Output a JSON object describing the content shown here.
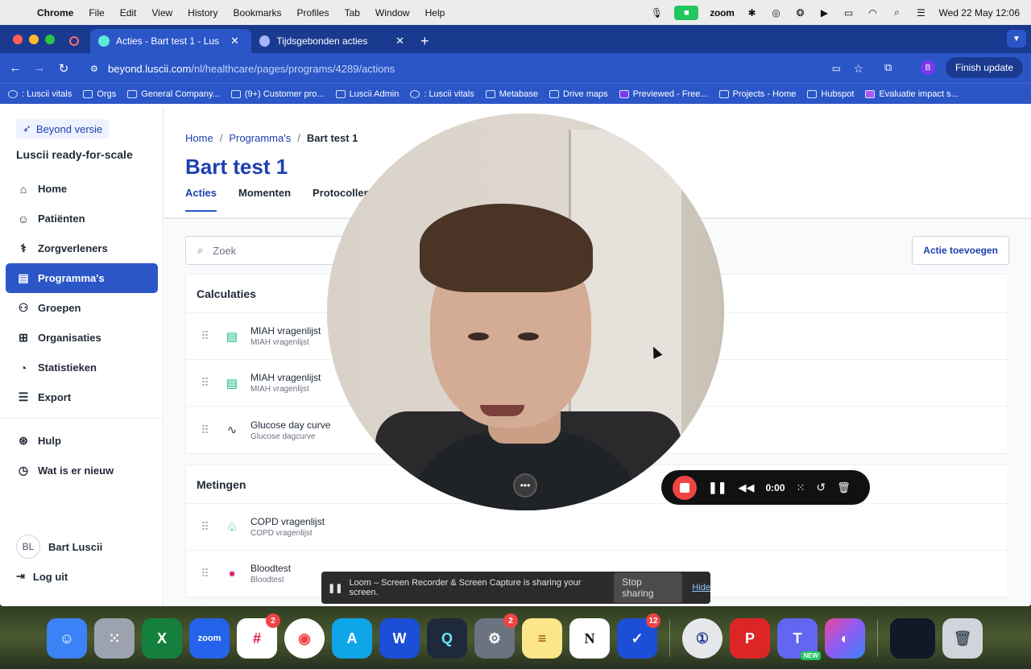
{
  "menubar": {
    "app": "Chrome",
    "items": [
      "File",
      "Edit",
      "View",
      "History",
      "Bookmarks",
      "Profiles",
      "Tab",
      "Window",
      "Help"
    ],
    "zoom_label": "zoom",
    "clock": "Wed 22 May  12:06"
  },
  "browser": {
    "tabs": [
      {
        "title": "Acties - Bart test 1 - Lusc"
      },
      {
        "title": "Tijdsgebonden acties"
      }
    ],
    "url_host": "beyond.luscii.com",
    "url_path": "/nl/healthcare/pages/programs/4289/actions",
    "finish_update": "Finish update",
    "profile_initial": "B",
    "bookmarks": [
      ": Luscii vitals",
      "Orgs",
      "General Company...",
      "(9+) Customer pro...",
      "Luscii Admin",
      ": Luscii vitals",
      "Metabase",
      "Drive maps",
      "Previewed - Free...",
      "Projects - Home",
      "Hubspot",
      "Evaluatie impact s..."
    ]
  },
  "sidebar": {
    "badge": "Beyond versie",
    "org": "Luscii ready-for-scale",
    "items": [
      {
        "label": "Home"
      },
      {
        "label": "Patiënten"
      },
      {
        "label": "Zorgverleners"
      },
      {
        "label": "Programma's"
      },
      {
        "label": "Groepen"
      },
      {
        "label": "Organisaties"
      },
      {
        "label": "Statistieken"
      },
      {
        "label": "Export"
      }
    ],
    "secondary": [
      {
        "label": "Hulp"
      },
      {
        "label": "Wat is er nieuw"
      }
    ],
    "user_initials": "BL",
    "user_name": "Bart Luscii",
    "logout": "Log uit"
  },
  "main": {
    "breadcrumb": [
      "Home",
      "Programma's",
      "Bart test 1"
    ],
    "title": "Bart test 1",
    "tabs": [
      "Acties",
      "Momenten",
      "Protocollen"
    ],
    "search_placeholder": "Zoek",
    "add_button": "Actie toevoegen",
    "sections": [
      {
        "title": "Calculaties",
        "rows": [
          {
            "title": "MIAH vragenlijst",
            "subtitle": "MIAH vragenlijst"
          },
          {
            "title": "MIAH vragenlijst",
            "subtitle": "MIAH vragenlijst"
          },
          {
            "title": "Glucose day curve",
            "subtitle": "Glucose dagcurve"
          }
        ]
      },
      {
        "title": "Metingen",
        "rows": [
          {
            "title": "COPD vragenlijst",
            "subtitle": "COPD vragenlijst"
          },
          {
            "title": "Bloodtest",
            "subtitle": "Bloodtest"
          }
        ]
      }
    ]
  },
  "recorder": {
    "time": "0:00"
  },
  "share_banner": {
    "text": "Loom – Screen Recorder & Screen Capture is sharing your screen.",
    "stop": "Stop sharing",
    "hide": "Hide"
  },
  "dock": {
    "zoom_label": "zoom",
    "badges": {
      "slack": "2",
      "settings": "2",
      "tasks": "12"
    },
    "teams_new": "NEW"
  }
}
